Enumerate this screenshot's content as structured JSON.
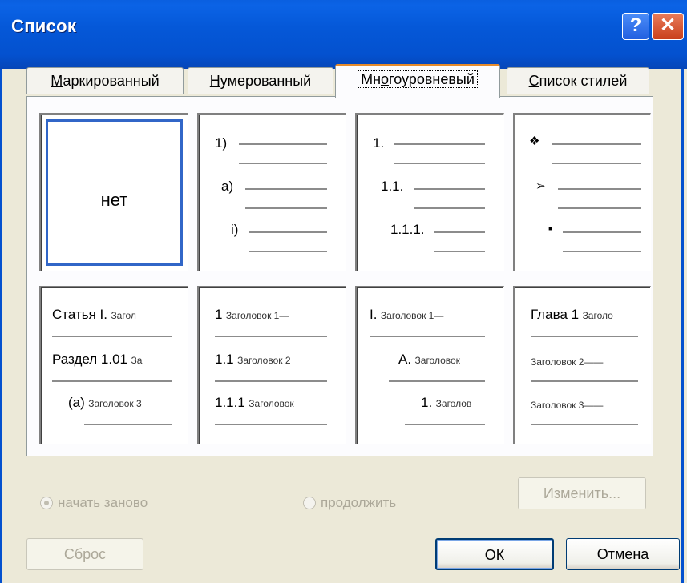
{
  "window": {
    "title": "Список"
  },
  "titlebar": {
    "help_label": "?",
    "close_label": "✕"
  },
  "tabs": [
    {
      "label": "Маркированный",
      "mnemonic": "М",
      "rest": "аркированный"
    },
    {
      "label": "Нумерованный",
      "mnemonic": "Н",
      "rest": "умерованный"
    },
    {
      "label": "Многоуровневый",
      "pre": "Мн",
      "mnemonic": "о",
      "rest": "гоуровневый"
    },
    {
      "label": "Список стилей",
      "mnemonic": "С",
      "rest": "писок стилей"
    }
  ],
  "gallery": {
    "none_label": "нет",
    "b1": {
      "l1": "1)",
      "l2": "a)",
      "l3": "i)"
    },
    "b2": {
      "l1": "1.",
      "l2": "1.1.",
      "l3": "1.1.1."
    },
    "b3": {
      "l1": "❖",
      "l2": "➢",
      "l3": "▪"
    },
    "b4": {
      "l1_main": "Статья I.",
      "l1_sub": "Загол",
      "l2_main": "Раздел 1.01",
      "l2_sub": "За",
      "l3_main": "(a)",
      "l3_sub": "Заголовок 3"
    },
    "b5": {
      "l1_main": "1",
      "l1_sub": "Заголовок 1—",
      "l2_main": "1.1",
      "l2_sub": "Заголовок 2",
      "l3_main": "1.1.1",
      "l3_sub": "Заголовок"
    },
    "b6": {
      "l1_main": "I.",
      "l1_sub": "Заголовок 1—",
      "l2_main": "A.",
      "l2_sub": "Заголовок",
      "l3_main": "1.",
      "l3_sub": "Заголов"
    },
    "b7": {
      "l1_main": "Глава 1",
      "l1_sub": "Заголо",
      "l2_sub": "Заголовок 2——",
      "l3_sub": "Заголовок 3——"
    }
  },
  "options": {
    "restart": "начать заново",
    "continue": "продолжить"
  },
  "buttons": {
    "change": "Изменить...",
    "reset": "Сброс",
    "ok": "ОК",
    "cancel": "Отмена"
  }
}
